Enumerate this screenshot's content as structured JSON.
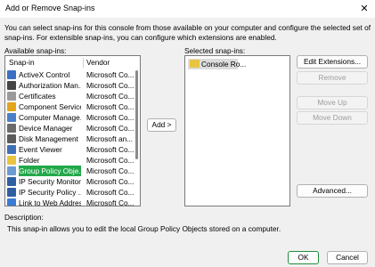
{
  "dialog": {
    "title": "Add or Remove Snap-ins",
    "close_glyph": "✕",
    "intro": "You can select snap-ins for this console from those available on your computer and configure the selected set of snap-ins. For extensible snap-ins, you can configure which extensions are enabled."
  },
  "available": {
    "label": "Available snap-ins:",
    "columns": [
      "Snap-in",
      "Vendor"
    ],
    "items": [
      {
        "name": "ActiveX Control",
        "vendor": "Microsoft Co...",
        "icon": "activex-icon",
        "color": "#3c6fc4"
      },
      {
        "name": "Authorization Man...",
        "vendor": "Microsoft Co...",
        "icon": "authorization-icon",
        "color": "#444444"
      },
      {
        "name": "Certificates",
        "vendor": "Microsoft Co...",
        "icon": "certificates-icon",
        "color": "#9a9a9a"
      },
      {
        "name": "Component Services",
        "vendor": "Microsoft Co...",
        "icon": "component-services-icon",
        "color": "#e2a51c"
      },
      {
        "name": "Computer Manage...",
        "vendor": "Microsoft Co...",
        "icon": "computer-management-icon",
        "color": "#4c7fc9"
      },
      {
        "name": "Device Manager",
        "vendor": "Microsoft Co...",
        "icon": "device-manager-icon",
        "color": "#6b6b6b"
      },
      {
        "name": "Disk Management",
        "vendor": "Microsoft an...",
        "icon": "disk-management-icon",
        "color": "#5b5b5b"
      },
      {
        "name": "Event Viewer",
        "vendor": "Microsoft Co...",
        "icon": "event-viewer-icon",
        "color": "#3f6fb6"
      },
      {
        "name": "Folder",
        "vendor": "Microsoft Co...",
        "icon": "folder-icon",
        "color": "#e8c441"
      },
      {
        "name": "Group Policy Obje...",
        "vendor": "Microsoft Co...",
        "icon": "group-policy-icon",
        "color": "#6a9bd2",
        "selected": true
      },
      {
        "name": "IP Security Monitor",
        "vendor": "Microsoft Co...",
        "icon": "ip-security-monitor-icon",
        "color": "#2f5fa3"
      },
      {
        "name": "IP Security Policy ...",
        "vendor": "Microsoft Co...",
        "icon": "ip-security-policy-icon",
        "color": "#2f5fa3"
      },
      {
        "name": "Link to Web Address",
        "vendor": "Microsoft Co...",
        "icon": "link-icon",
        "color": "#3a7bd5"
      }
    ]
  },
  "add_button": "Add >",
  "selected": {
    "label": "Selected snap-ins:",
    "items": [
      {
        "name": "Console Ro...",
        "icon": "folder-icon"
      }
    ]
  },
  "side_buttons": {
    "edit_extensions": "Edit Extensions...",
    "remove": "Remove",
    "move_up": "Move Up",
    "move_down": "Move Down",
    "advanced": "Advanced..."
  },
  "description": {
    "label": "Description:",
    "text": "This snap-in allows you to edit the local Group Policy Objects stored on a computer."
  },
  "footer": {
    "ok": "OK",
    "cancel": "Cancel"
  },
  "colors": {
    "selection": "#22a84a",
    "primary_border": "#1f8f3d"
  }
}
